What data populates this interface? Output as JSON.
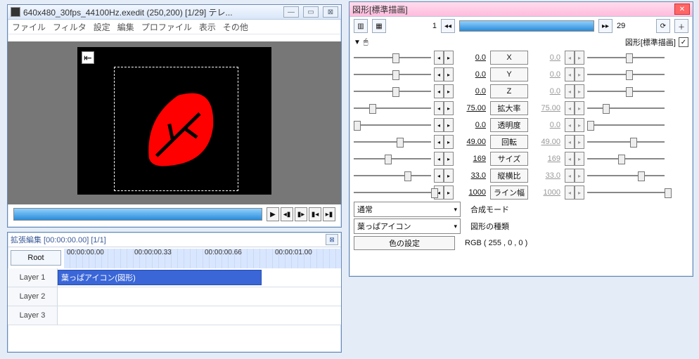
{
  "main_window": {
    "title": "640x480_30fps_44100Hz.exedit (250,200)  [1/29]  テレ...",
    "menu": [
      "ファイル",
      "フィルタ",
      "設定",
      "編集",
      "プロファイル",
      "表示",
      "その他"
    ]
  },
  "timeline": {
    "title": "拡張編集 [00:00:00.00] [1/1]",
    "root": "Root",
    "times": [
      "00:00:00.00",
      "00:00:00.33",
      "00:00:00.66",
      "00:00:01.00"
    ],
    "layers": [
      "Layer 1",
      "Layer 2",
      "Layer 3"
    ],
    "clip": "葉っぱアイコン(図形)"
  },
  "props": {
    "title": "図形[標準描画]",
    "frame_cur": "1",
    "frame_end": "29",
    "header_label": "図形[標準描画]",
    "params": [
      {
        "name": "X",
        "v1": "0.0",
        "v2": "0.0",
        "t1": 50,
        "t2": 50
      },
      {
        "name": "Y",
        "v1": "0.0",
        "v2": "0.0",
        "t1": 50,
        "t2": 50
      },
      {
        "name": "Z",
        "v1": "0.0",
        "v2": "0.0",
        "t1": 50,
        "t2": 50
      },
      {
        "name": "拡大率",
        "v1": "75.00",
        "v2": "75.00",
        "t1": 20,
        "t2": 20
      },
      {
        "name": "透明度",
        "v1": "0.0",
        "v2": "0.0",
        "t1": 0,
        "t2": 0
      },
      {
        "name": "回転",
        "v1": "49.00",
        "v2": "49.00",
        "t1": 55,
        "t2": 55
      },
      {
        "name": "サイズ",
        "v1": "169",
        "v2": "169",
        "t1": 40,
        "t2": 40
      },
      {
        "name": "縦横比",
        "v1": "33.0",
        "v2": "33.0",
        "t1": 65,
        "t2": 65
      },
      {
        "name": "ライン幅",
        "v1": "1000",
        "v2": "1000",
        "t1": 100,
        "t2": 100
      }
    ],
    "blend_label": "合成モード",
    "blend_val": "通常",
    "type_label": "図形の種類",
    "type_val": "葉っぱアイコン",
    "color_btn": "色の設定",
    "color_val": "RGB ( 255 , 0 , 0 )"
  }
}
